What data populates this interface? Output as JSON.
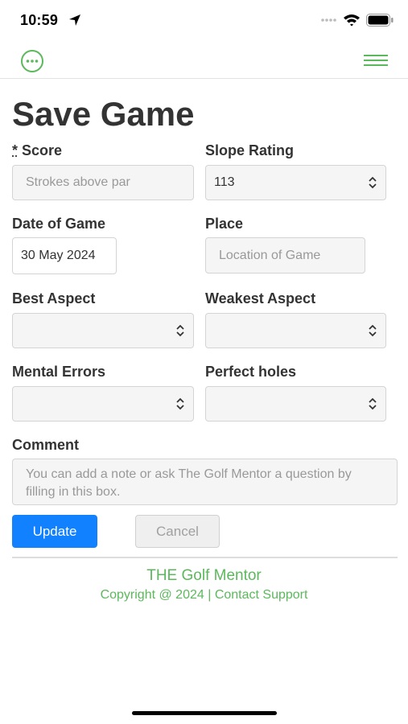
{
  "status_bar": {
    "time": "10:59"
  },
  "page": {
    "title": "Save Game"
  },
  "form": {
    "score": {
      "required_mark": "*",
      "label": "Score",
      "placeholder": "Strokes above par"
    },
    "slope_rating": {
      "label": "Slope Rating",
      "value": "113"
    },
    "date_of_game": {
      "label": "Date of Game",
      "value": "30 May 2024"
    },
    "place": {
      "label": "Place",
      "placeholder": "Location of Game"
    },
    "best_aspect": {
      "label": "Best Aspect",
      "value": ""
    },
    "weakest_aspect": {
      "label": "Weakest Aspect",
      "value": ""
    },
    "mental_errors": {
      "label": "Mental Errors",
      "value": ""
    },
    "perfect_holes": {
      "label": "Perfect holes",
      "value": ""
    },
    "comment": {
      "label": "Comment",
      "placeholder": "You can add a note or ask The Golf Mentor a question by filling in this box."
    }
  },
  "buttons": {
    "update": "Update",
    "cancel": "Cancel"
  },
  "footer": {
    "title": "THE Golf Mentor",
    "copyright": "Copyright @ 2024 | Contact Support"
  },
  "colors": {
    "accent_green": "#5cb85c",
    "primary_blue": "#1181ff"
  },
  "icons": {
    "menu_left": "more-circle-icon",
    "menu_right": "hamburger-icon",
    "select": "chevron-updown-icon"
  }
}
